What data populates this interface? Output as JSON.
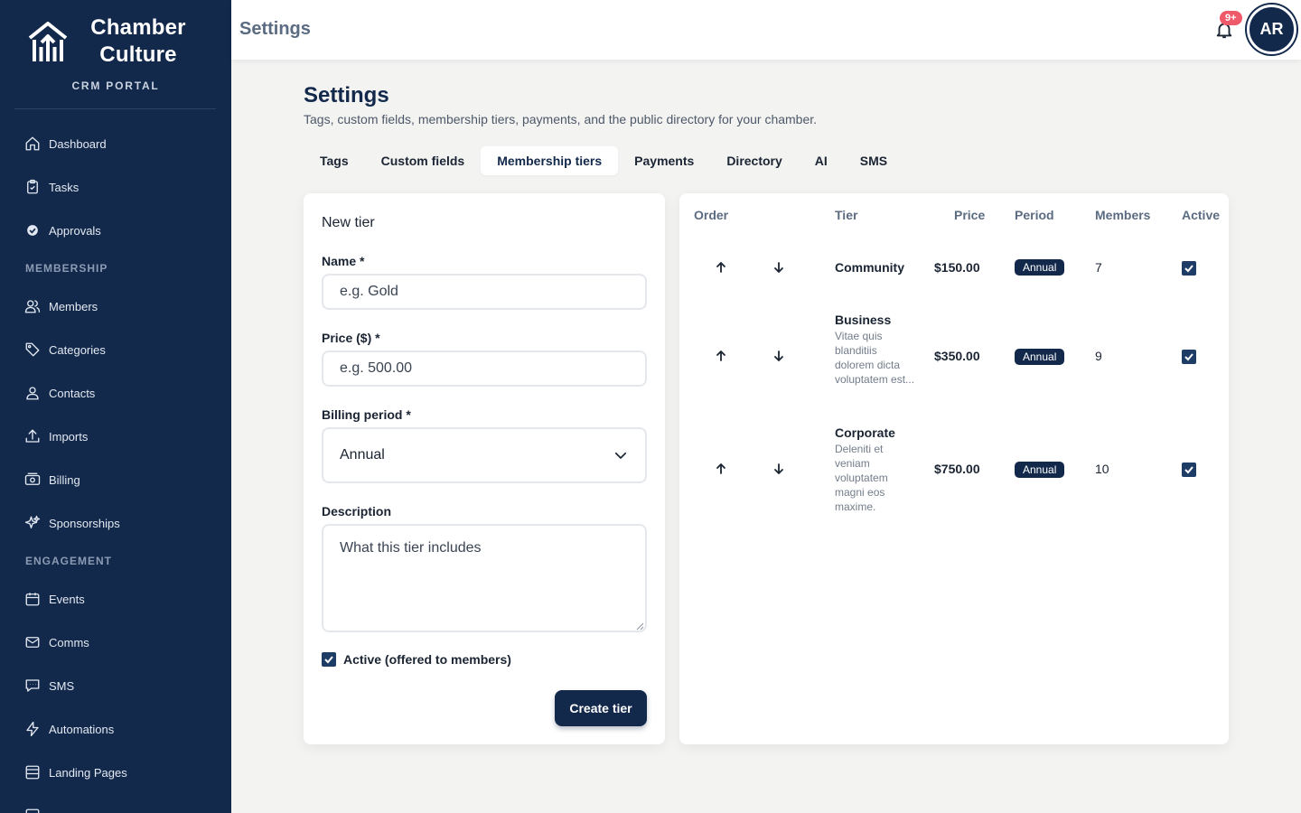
{
  "brand": {
    "name_line1": "Chamber",
    "name_line2": "Culture",
    "subtitle": "CRM PORTAL"
  },
  "nav": {
    "dashboard": "Dashboard",
    "tasks": "Tasks",
    "approvals": "Approvals",
    "section_membership": "MEMBERSHIP",
    "members": "Members",
    "categories": "Categories",
    "contacts": "Contacts",
    "imports": "Imports",
    "billing": "Billing",
    "sponsorships": "Sponsorships",
    "section_engagement": "ENGAGEMENT",
    "events": "Events",
    "comms": "Comms",
    "sms": "SMS",
    "automations": "Automations",
    "landing_pages": "Landing Pages"
  },
  "topbar": {
    "title": "Settings",
    "notification_badge": "9+",
    "avatar_initials": "AR"
  },
  "page": {
    "title": "Settings",
    "subtitle": "Tags, custom fields, membership tiers, payments, and the public directory for your chamber."
  },
  "tabs": [
    "Tags",
    "Custom fields",
    "Membership tiers",
    "Payments",
    "Directory",
    "AI",
    "SMS"
  ],
  "active_tab": "Membership tiers",
  "form": {
    "heading": "New tier",
    "name_label": "Name *",
    "name_placeholder": "e.g. Gold",
    "price_label": "Price ($) *",
    "price_placeholder": "e.g. 500.00",
    "period_label": "Billing period *",
    "period_value": "Annual",
    "description_label": "Description",
    "description_placeholder": "What this tier includes",
    "active_label": "Active (offered to members)",
    "active_checked": true,
    "submit_label": "Create tier"
  },
  "table": {
    "headers": {
      "order": "Order",
      "tier": "Tier",
      "price": "Price",
      "period": "Period",
      "members": "Members",
      "active": "Active"
    },
    "rows": [
      {
        "name": "Community",
        "description": "",
        "price": "$150.00",
        "period": "Annual",
        "members": "7",
        "active": true
      },
      {
        "name": "Business",
        "description": "Vitae quis blanditiis dolorem dicta voluptatem est...",
        "price": "$350.00",
        "period": "Annual",
        "members": "9",
        "active": true
      },
      {
        "name": "Corporate",
        "description": "Deleniti et veniam voluptatem magni eos maxime.",
        "price": "$750.00",
        "period": "Annual",
        "members": "10",
        "active": true
      }
    ]
  },
  "colors": {
    "sidebar": "#13294b",
    "accent": "#13294b",
    "badge": "#ef5a6a",
    "background": "#f3f3f2"
  }
}
